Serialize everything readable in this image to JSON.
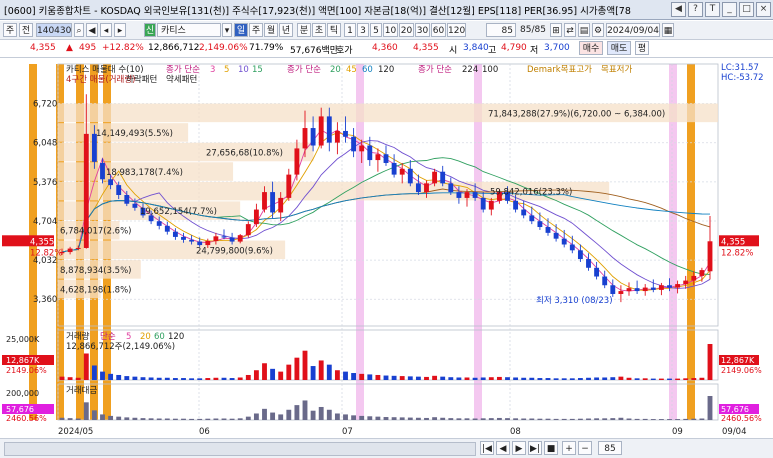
{
  "window": {
    "title": "[0600] 키움종합차트 - KOSDAQ 외국인보유[131(천)] 주식수[17,923(천)] 액면[100] 자본금[18(억)] 결산[12월] EPS[118] PER[36.95] 시가총액[78",
    "controls": [
      "◀",
      "?",
      "T",
      "_",
      "□",
      "×"
    ]
  },
  "toolbar": {
    "period_label": "주",
    "item_type": "전",
    "stock_code": "140430",
    "stock_name": "카티스",
    "credit_badge": "신",
    "date_input": "2024/09/04",
    "count_display": "85",
    "count_total": "85/85",
    "buttons": [
      "일",
      "주",
      "월",
      "년",
      "분",
      "초",
      "틱"
    ],
    "interval_buttons": [
      "1",
      "3",
      "5",
      "10",
      "20",
      "30",
      "60",
      "120"
    ]
  },
  "quote": {
    "price": "4,355",
    "change": "495",
    "change_arrow": "▲",
    "change_pct": "+12.82%",
    "volume": "12,866,712",
    "volume_pct": "2,149.06%",
    "turnover_pct": "71.79%",
    "amount": "57,676백만",
    "ask_label": "호가",
    "ask1": "4,360",
    "bid1": "4,355",
    "open_label": "시",
    "open": "3,840",
    "high_label": "고",
    "high": "4,790",
    "low_label": "저",
    "low": "3,700",
    "buy_btn": "매수",
    "sell_btn": "매도",
    "eval_btn": "평"
  },
  "chart_data": {
    "type": "candlestick",
    "legend_price_top": {
      "name": "카티스 매물대 수(10)",
      "ma_label": "종가 단순",
      "ma_values": [
        "3",
        "5",
        "10",
        "15"
      ],
      "ma2_label": "종가 단순",
      "ma2_values": [
        "20",
        "45",
        "60",
        "120"
      ],
      "ma3_label": "종가 단순",
      "ma3_values": [
        "224",
        "100"
      ],
      "demark": "Demark목표고가",
      "demark_low": "목표저가",
      "pattern": "하락패턴",
      "pattern2": "약세패턴",
      "overlay": "4구간 매물(거래량)"
    },
    "price_axis": {
      "ticks": [
        "6,720",
        "6,048",
        "5,376",
        "4,704",
        "4,032",
        "3,360"
      ],
      "ymin": 2900,
      "ymax": 7400
    },
    "right_axis": {
      "lc": "LC:31.57",
      "hc": "HC:-53.72",
      "price_tag": "4,355",
      "pct_tag": "12.82%"
    },
    "left_tags": {
      "price_tag": "4,355",
      "pct_tag": "12.82%"
    },
    "volume_profile": [
      {
        "label": "71,843,288(27.9%)(6,720.00 ~ 6,384.00)",
        "price_low": 6384,
        "price_high": 6720,
        "pct": 27.9
      },
      {
        "label": "14,149,493(5.5%)",
        "price_low": 6048,
        "price_high": 6384,
        "pct": 5.5
      },
      {
        "label": "27,656,68(10.8%)",
        "price_low": 5712,
        "price_high": 6048,
        "pct": 10.8
      },
      {
        "label": "18,983,178(7.4%)",
        "price_low": 5376,
        "price_high": 5712,
        "pct": 7.4
      },
      {
        "label": "59,842,016(23.3%)",
        "price_low": 5040,
        "price_high": 5376,
        "pct": 23.3
      },
      {
        "label": "19,652,154(7.7%)",
        "price_low": 4704,
        "price_high": 5040,
        "pct": 7.7
      },
      {
        "label": "6,784,017(2.6%)",
        "price_low": 4368,
        "price_high": 4704,
        "pct": 2.6
      },
      {
        "label": "24,799,800(9.6%)",
        "price_low": 4032,
        "price_high": 4368,
        "pct": 9.6
      },
      {
        "label": "8,878,934(3.5%)",
        "price_low": 3696,
        "price_high": 4032,
        "pct": 3.5
      },
      {
        "label": "4,628,198(1.8%)",
        "price_low": 3360,
        "price_high": 3696,
        "pct": 1.8
      }
    ],
    "low_annotation": "최저 3,310 (08/23)",
    "volume_panel": {
      "legend": "거래량",
      "ma_label": "단순",
      "ma_values": [
        "5",
        "20",
        "60",
        "120"
      ],
      "info": "12,866,712주(2,149.06%)",
      "axis_tick": "25,000K",
      "left_tag": "12,867K",
      "left_pct": "2149.06%",
      "right_tag": "12,867K",
      "right_pct": "2149.06%"
    },
    "amount_panel": {
      "legend": "거래대금",
      "axis_tick": "200,000",
      "left_tag": "57,676",
      "left_pct": "2460.56%",
      "right_tag": "57,676",
      "right_pct": "2460.56%"
    },
    "x_labels": [
      "2024/05",
      "06",
      "07",
      "08",
      "09",
      "09/04"
    ],
    "candles": [
      [
        4150,
        4230,
        4120,
        4170
      ],
      [
        4170,
        4260,
        4130,
        4230
      ],
      [
        4230,
        4280,
        4200,
        4240
      ],
      [
        4240,
        6880,
        4230,
        6200
      ],
      [
        6200,
        6350,
        5600,
        5720
      ],
      [
        5700,
        5780,
        5350,
        5420
      ],
      [
        5420,
        5500,
        5250,
        5320
      ],
      [
        5320,
        5380,
        5080,
        5150
      ],
      [
        5150,
        5220,
        4960,
        5000
      ],
      [
        5000,
        5090,
        4880,
        4930
      ],
      [
        4930,
        5000,
        4760,
        4800
      ],
      [
        4800,
        4880,
        4650,
        4700
      ],
      [
        4700,
        4780,
        4560,
        4620
      ],
      [
        4620,
        4690,
        4470,
        4520
      ],
      [
        4520,
        4580,
        4380,
        4430
      ],
      [
        4430,
        4500,
        4330,
        4380
      ],
      [
        4380,
        4460,
        4300,
        4350
      ],
      [
        4350,
        4420,
        4260,
        4290
      ],
      [
        4290,
        4400,
        4240,
        4360
      ],
      [
        4360,
        4500,
        4300,
        4440
      ],
      [
        4440,
        4560,
        4390,
        4420
      ],
      [
        4420,
        4500,
        4300,
        4350
      ],
      [
        4350,
        4480,
        4320,
        4460
      ],
      [
        4460,
        4700,
        4420,
        4650
      ],
      [
        4650,
        5000,
        4600,
        4900
      ],
      [
        4900,
        5300,
        4850,
        5200
      ],
      [
        5200,
        5380,
        4750,
        4850
      ],
      [
        4850,
        5200,
        4700,
        5100
      ],
      [
        5100,
        5600,
        5050,
        5500
      ],
      [
        5500,
        6100,
        5400,
        5950
      ],
      [
        5950,
        6600,
        5800,
        6300
      ],
      [
        6300,
        6500,
        5900,
        6000
      ],
      [
        6000,
        6650,
        5950,
        6500
      ],
      [
        6500,
        6650,
        5900,
        6050
      ],
      [
        6050,
        6400,
        5850,
        6250
      ],
      [
        6250,
        6500,
        6050,
        6150
      ],
      [
        6150,
        6300,
        5800,
        5900
      ],
      [
        5900,
        6100,
        5700,
        6000
      ],
      [
        6000,
        6150,
        5650,
        5750
      ],
      [
        5750,
        5950,
        5550,
        5850
      ],
      [
        5850,
        6000,
        5650,
        5700
      ],
      [
        5700,
        5850,
        5450,
        5500
      ],
      [
        5500,
        5700,
        5350,
        5600
      ],
      [
        5600,
        5750,
        5300,
        5350
      ],
      [
        5350,
        5500,
        5150,
        5200
      ],
      [
        5200,
        5400,
        5100,
        5350
      ],
      [
        5350,
        5600,
        5300,
        5550
      ],
      [
        5550,
        5650,
        5300,
        5350
      ],
      [
        5350,
        5450,
        5150,
        5200
      ],
      [
        5200,
        5300,
        5000,
        5100
      ],
      [
        5100,
        5250,
        4950,
        5200
      ],
      [
        5200,
        5350,
        5050,
        5100
      ],
      [
        5100,
        5200,
        4850,
        4900
      ],
      [
        4900,
        5100,
        4800,
        5050
      ],
      [
        5050,
        5250,
        5000,
        5200
      ],
      [
        5200,
        5300,
        5000,
        5050
      ],
      [
        5050,
        5150,
        4850,
        4900
      ],
      [
        4900,
        5050,
        4750,
        4800
      ],
      [
        4800,
        4950,
        4650,
        4700
      ],
      [
        4700,
        4850,
        4550,
        4600
      ],
      [
        4600,
        4750,
        4450,
        4500
      ],
      [
        4500,
        4650,
        4350,
        4400
      ],
      [
        4400,
        4550,
        4250,
        4300
      ],
      [
        4300,
        4450,
        4150,
        4200
      ],
      [
        4200,
        4300,
        4000,
        4050
      ],
      [
        4050,
        4150,
        3850,
        3900
      ],
      [
        3900,
        4000,
        3700,
        3750
      ],
      [
        3750,
        3850,
        3550,
        3600
      ],
      [
        3600,
        3700,
        3400,
        3450
      ],
      [
        3450,
        3600,
        3310,
        3500
      ],
      [
        3500,
        3650,
        3420,
        3550
      ],
      [
        3550,
        3680,
        3450,
        3500
      ],
      [
        3500,
        3620,
        3420,
        3560
      ],
      [
        3560,
        3700,
        3480,
        3520
      ],
      [
        3520,
        3640,
        3430,
        3600
      ],
      [
        3600,
        3720,
        3500,
        3560
      ],
      [
        3560,
        3680,
        3460,
        3620
      ],
      [
        3620,
        3760,
        3540,
        3680
      ],
      [
        3680,
        3840,
        3600,
        3760
      ],
      [
        3760,
        3900,
        3660,
        3860
      ],
      [
        3840,
        4790,
        3700,
        4355
      ]
    ],
    "volumes": [
      1.2,
      1.0,
      0.8,
      9.5,
      5.2,
      3.0,
      2.2,
      1.8,
      1.4,
      1.2,
      1.0,
      0.9,
      0.8,
      0.8,
      0.7,
      0.7,
      0.6,
      0.6,
      0.7,
      0.8,
      0.8,
      0.7,
      0.9,
      1.8,
      3.5,
      6.0,
      4.0,
      3.0,
      5.5,
      8.0,
      10.5,
      5.0,
      7.0,
      5.5,
      3.5,
      3.0,
      2.5,
      2.2,
      2.0,
      1.8,
      1.6,
      1.5,
      1.4,
      1.3,
      1.2,
      1.1,
      1.5,
      1.2,
      1.0,
      0.9,
      0.9,
      0.8,
      0.9,
      1.0,
      1.1,
      1.0,
      0.9,
      0.8,
      0.8,
      0.7,
      0.7,
      0.6,
      0.6,
      0.6,
      0.7,
      0.8,
      0.9,
      0.9,
      1.0,
      1.2,
      0.8,
      0.6,
      0.6,
      0.5,
      0.5,
      0.5,
      0.5,
      0.6,
      0.7,
      0.8,
      12.9
    ],
    "highlight_orange": [
      33,
      60,
      80,
      94,
      107,
      691
    ],
    "highlight_pink": [
      360,
      478,
      673
    ]
  },
  "bottom": {
    "buttons": [
      "|◀",
      "◀",
      "▶",
      "▶|",
      "■",
      "+",
      "−"
    ],
    "zoom_label": "85"
  },
  "colors": {
    "up": "#e0101a",
    "down": "#1840d0",
    "orange_band": "#f0a020",
    "pink_band": "#f4c8f0",
    "profile": "#f5e0c8"
  }
}
